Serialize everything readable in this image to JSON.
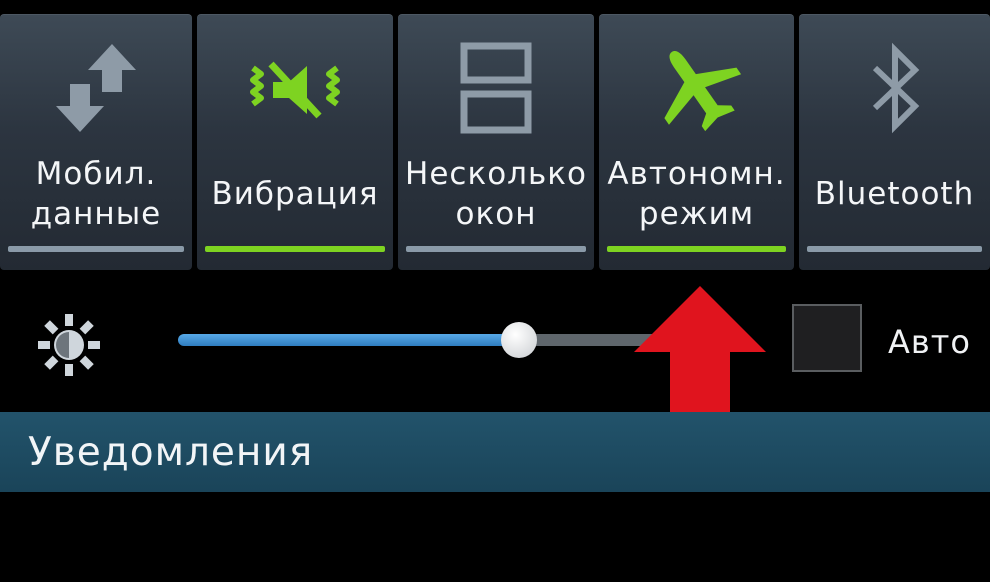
{
  "quick_settings": [
    {
      "id": "mobile-data",
      "label_line1": "Мобил.",
      "label_line2": "данные",
      "active": false,
      "icon": "mobile-data-icon"
    },
    {
      "id": "vibration",
      "label_line1": "Вибрация",
      "label_line2": "",
      "active": true,
      "icon": "vibration-icon"
    },
    {
      "id": "multi-window",
      "label_line1": "Несколько",
      "label_line2": "окон",
      "active": false,
      "icon": "multi-window-icon"
    },
    {
      "id": "airplane",
      "label_line1": "Автономн.",
      "label_line2": "режим",
      "active": true,
      "icon": "airplane-icon"
    },
    {
      "id": "bluetooth",
      "label_line1": "Bluetooth",
      "label_line2": "",
      "active": false,
      "icon": "bluetooth-icon"
    }
  ],
  "brightness": {
    "level": 0.63,
    "auto_label": "Авто",
    "auto_checked": false
  },
  "notifications": {
    "title": "Уведомления"
  },
  "colors": {
    "active_green": "#7ed321",
    "inactive_gray": "#8a9aa8",
    "slider_blue": "#2f7dbf",
    "arrow_red": "#e0141e",
    "notif_bar": "#1f4c63"
  }
}
